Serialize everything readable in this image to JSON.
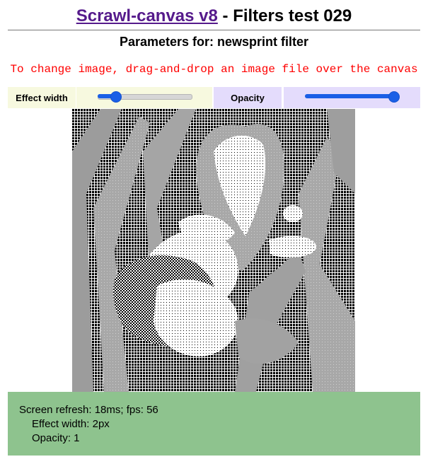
{
  "header": {
    "link_text": "Scrawl-canvas v8",
    "title_suffix": " - Filters test 029",
    "subtitle": "Parameters for: newsprint filter",
    "instruction": "To change image, drag-and-drop an image file over the canvas"
  },
  "controls": {
    "effect_width": {
      "label": "Effect width",
      "value_fraction": 0.2
    },
    "opacity": {
      "label": "Opacity",
      "value_fraction": 1.0
    }
  },
  "report": {
    "refresh_line": "Screen refresh: 18ms; fps: 56",
    "effect_width_line": "Effect width: 2px",
    "opacity_line": "Opacity: 1"
  },
  "colors": {
    "link": "#551a8b",
    "instruction": "#ff0000",
    "effect_panel": "#f7f9df",
    "opacity_panel": "#e4dcfc",
    "slider": "#1a5fe6",
    "report_panel": "#8ec38e"
  }
}
